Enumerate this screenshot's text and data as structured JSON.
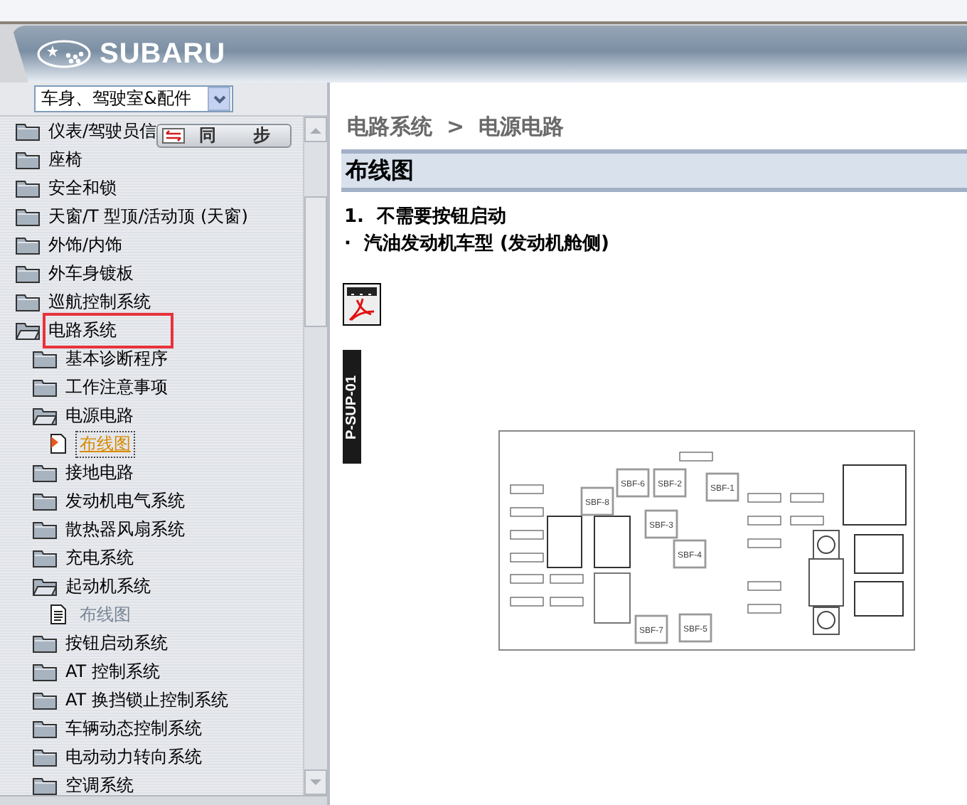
{
  "header": {
    "brand": "SUBARU"
  },
  "sidebar": {
    "category": "车身、驾驶室&配件",
    "sync_button": "同 步",
    "tree": [
      {
        "label": "仪表/驾驶员信",
        "kind": "folder",
        "expanded": false,
        "marked": false
      },
      {
        "label": "座椅",
        "kind": "folder",
        "expanded": false,
        "marked": false
      },
      {
        "label": "安全和锁",
        "kind": "folder",
        "expanded": false,
        "marked": false
      },
      {
        "label": "天窗/T 型顶/活动顶 (天窗)",
        "kind": "folder",
        "expanded": false,
        "marked": false
      },
      {
        "label": "外饰/内饰",
        "kind": "folder",
        "expanded": false,
        "marked": false
      },
      {
        "label": "外车身镀板",
        "kind": "folder",
        "expanded": false,
        "marked": false
      },
      {
        "label": "巡航控制系统",
        "kind": "folder",
        "expanded": false,
        "marked": false
      },
      {
        "label": "电路系统",
        "kind": "folder",
        "expanded": true,
        "marked": true,
        "children": [
          {
            "label": "基本诊断程序",
            "kind": "folder",
            "expanded": false,
            "marked": false
          },
          {
            "label": "工作注意事项",
            "kind": "folder",
            "expanded": false,
            "marked": false
          },
          {
            "label": "电源电路",
            "kind": "folder",
            "expanded": true,
            "marked": false,
            "children": [
              {
                "label": "布线图",
                "kind": "document",
                "selected": true
              }
            ]
          },
          {
            "label": "接地电路",
            "kind": "folder",
            "expanded": false,
            "marked": false
          },
          {
            "label": "发动机电气系统",
            "kind": "folder",
            "expanded": false,
            "marked": false
          },
          {
            "label": "散热器风扇系统",
            "kind": "folder",
            "expanded": false,
            "marked": false
          },
          {
            "label": "充电系统",
            "kind": "folder",
            "expanded": false,
            "marked": false
          },
          {
            "label": "起动机系统",
            "kind": "folder",
            "expanded": true,
            "marked": false,
            "children": [
              {
                "label": "布线图",
                "kind": "document",
                "selected": false
              }
            ]
          },
          {
            "label": "按钮启动系统",
            "kind": "folder",
            "expanded": false,
            "marked": false
          },
          {
            "label": "AT 控制系统",
            "kind": "folder",
            "expanded": false,
            "marked": false
          },
          {
            "label": "AT 换挡锁止控制系统",
            "kind": "folder",
            "expanded": false,
            "marked": false
          },
          {
            "label": "车辆动态控制系统",
            "kind": "folder",
            "expanded": false,
            "marked": false
          },
          {
            "label": "电动动力转向系统",
            "kind": "folder",
            "expanded": false,
            "marked": false
          },
          {
            "label": "空调系统",
            "kind": "folder",
            "expanded": false,
            "marked": false
          }
        ]
      }
    ]
  },
  "content": {
    "breadcrumb": [
      "电路系统",
      "电源电路"
    ],
    "separator": ">",
    "heading": "布线图",
    "lines": [
      "1.  不需要按钮启动",
      "·  汽油发动机车型 (发动机舱侧)"
    ],
    "page_tab": "P-SUP-01",
    "fuse_box": {
      "sbf": [
        {
          "label": "SBF-6"
        },
        {
          "label": "SBF-2"
        },
        {
          "label": "SBF-1"
        },
        {
          "label": "SBF-8"
        },
        {
          "label": "SBF-3"
        },
        {
          "label": "SBF-4"
        },
        {
          "label": "SBF-7"
        },
        {
          "label": "SBF-5"
        }
      ]
    }
  }
}
